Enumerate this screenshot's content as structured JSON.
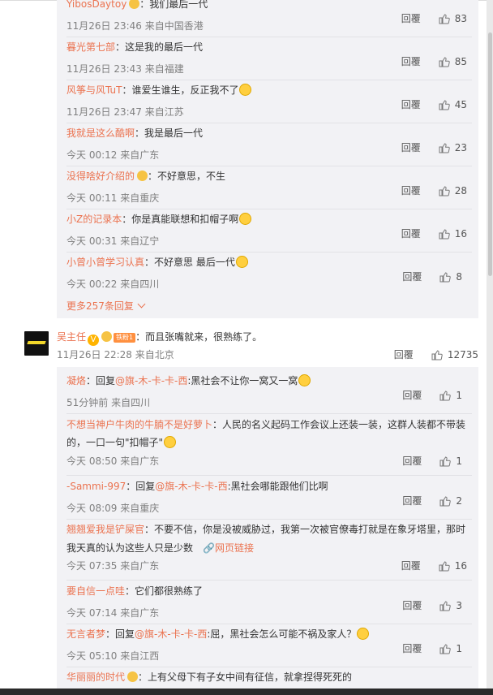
{
  "labels": {
    "reply": "回覆"
  },
  "colors": {
    "accent": "#eb7350",
    "meta": "#808080",
    "reply_bg": "#f2f2f5"
  },
  "replies_a": [
    {
      "name": "YibosDaytoy",
      "text": "：我们最后一代",
      "time": "11月26日 23:46 来自中国香港",
      "likes": "83"
    },
    {
      "name": "暮光第七部",
      "text": "：这是我的最后一代",
      "time": "11月26日 23:43 来自福建",
      "likes": "85"
    },
    {
      "name": "风筝与风TuT",
      "text": "：谁爱生谁生，反正我不了",
      "time": "11月26日 23:47 来自江苏",
      "likes": "45"
    },
    {
      "name": "我就是这么酷啊",
      "text": "：我是最后一代",
      "time": "今天 00:12 来自广东",
      "likes": "23"
    },
    {
      "name": "没得啥好介绍的",
      "text": "：不好意思，不生",
      "time": "今天 00:11 来自重庆",
      "likes": "28"
    },
    {
      "name": "小Z的记录本",
      "text": "：你是真能联想和扣帽子啊",
      "time": "今天 00:31 来自辽宁",
      "likes": "16"
    },
    {
      "name": "小曾小曾学习认真",
      "text": "：不好意思 最后一代",
      "time": "今天 00:22 来自四川",
      "likes": "8"
    }
  ],
  "more_replies": "更多257条回复",
  "main_comment": {
    "name": "吴主任",
    "fans_badge": "铁粉1",
    "text": "：而且张嘴就来，很熟练了。",
    "time": "11月26日 22:28 来自北京",
    "likes": "12735"
  },
  "replies_b": [
    {
      "name": "凝烙",
      "prefix": "：回复",
      "at": "@旗-木-卡-卡-西",
      "text": ":黑社会不让你一窝又一窝",
      "time": "51分钟前 来自四川",
      "likes": "1"
    },
    {
      "name": "不想当神户牛肉的牛腩不是好萝卜",
      "text": "：人民的名义起码工作会议上还装一装，这群人装都不带装",
      "text2": "的，一口一句\"扣帽子\"",
      "time": "今天 08:50 来自广东",
      "likes": "1"
    },
    {
      "name": "-Sammi-997",
      "prefix": "：回复",
      "at": "@旗-木-卡-卡-西",
      "text": ":黑社会哪能跟他们比啊",
      "time": "今天 08:09 来自重庆",
      "likes": "2"
    },
    {
      "name": "翘翘爱我是铲屎官",
      "text": "：不要不信，你是没被威胁过，我第一次被官僚毒打就是在象牙塔里，那时",
      "text2": "我天真的认为这些人只是少数",
      "link": "网页链接",
      "time": "今天 07:35 来自广东",
      "likes": "16"
    },
    {
      "name": "要自信一点哇",
      "text": "：它们都很熟练了",
      "time": "今天 07:14 来自广东",
      "likes": "3"
    },
    {
      "name": "无言者梦",
      "prefix": "：回复",
      "at": "@旗-木-卡-卡-西",
      "text": ":屈，黑社会怎么可能不祸及家人？",
      "time": "今天 05:10 来自江西",
      "likes": "1"
    },
    {
      "name": "华丽丽的时代",
      "text": "：上有父母下有子女中间有征信，就拿捏得死死的"
    }
  ]
}
